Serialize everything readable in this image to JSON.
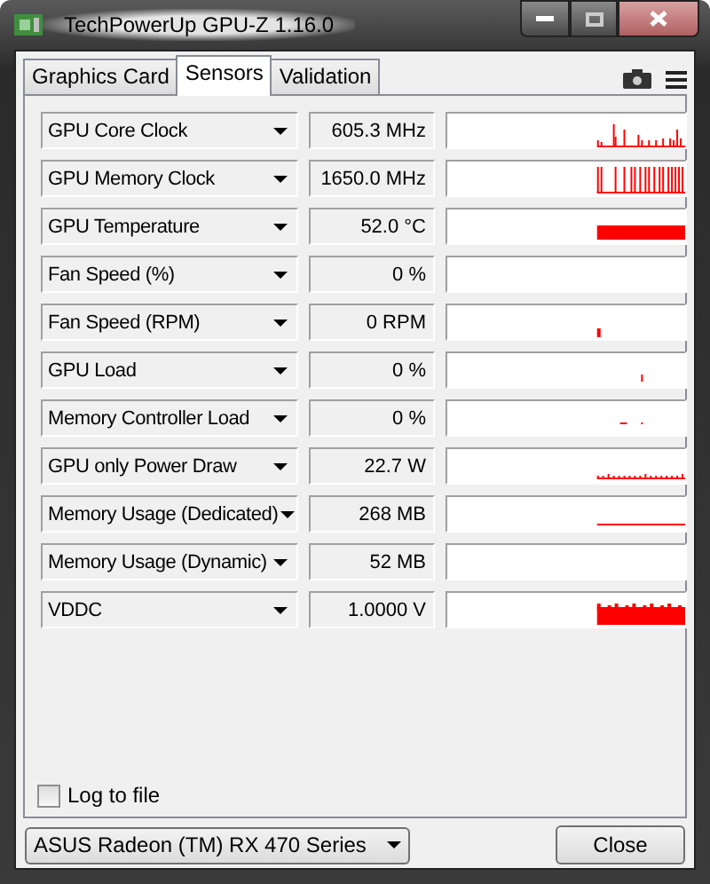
{
  "window": {
    "title": "TechPowerUp GPU-Z 1.16.0"
  },
  "tabs": [
    {
      "label": "Graphics Card",
      "selected": false
    },
    {
      "label": "Sensors",
      "selected": true
    },
    {
      "label": "Validation",
      "selected": false
    }
  ],
  "sensors": [
    {
      "name": "GPU Core Clock",
      "value": "605.3 MHz",
      "kind": "spikes"
    },
    {
      "name": "GPU Memory Clock",
      "value": "1650.0 MHz",
      "kind": "bars"
    },
    {
      "name": "GPU Temperature",
      "value": "52.0 °C",
      "kind": "block"
    },
    {
      "name": "Fan Speed (%)",
      "value": "0 %",
      "kind": "empty"
    },
    {
      "name": "Fan Speed (RPM)",
      "value": "0 RPM",
      "kind": "blip"
    },
    {
      "name": "GPU Load",
      "value": "0 %",
      "kind": "tick"
    },
    {
      "name": "Memory Controller Load",
      "value": "0 %",
      "kind": "dots"
    },
    {
      "name": "GPU only Power Draw",
      "value": "22.7 W",
      "kind": "low"
    },
    {
      "name": "Memory Usage (Dedicated)",
      "value": "268 MB",
      "kind": "line"
    },
    {
      "name": "Memory Usage (Dynamic)",
      "value": "52 MB",
      "kind": "empty"
    },
    {
      "name": "VDDC",
      "value": "1.0000 V",
      "kind": "solid"
    }
  ],
  "log_to_file": {
    "label": "Log to file",
    "checked": false
  },
  "device": {
    "value": "ASUS Radeon (TM) RX 470 Series"
  },
  "close_button": "Close"
}
